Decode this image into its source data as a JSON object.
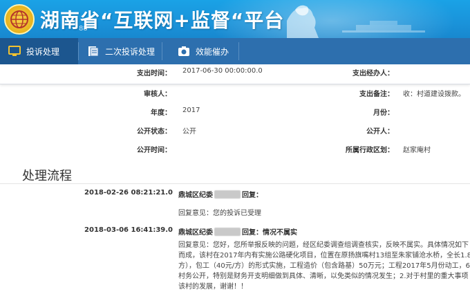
{
  "banner": {
    "title": "湖南省“互联网+监督“平台",
    "number": "88"
  },
  "nav": {
    "items": [
      {
        "label": "投诉处理",
        "icon": "monitor-icon",
        "active": true
      },
      {
        "label": "二次投诉处理",
        "icon": "document-icon",
        "active": false
      },
      {
        "label": "效能催办",
        "icon": "camera-icon",
        "active": false
      }
    ]
  },
  "details": {
    "pay_time_label": "支出时间：",
    "pay_time_value": "2017-06-30 00:00:00.0",
    "payer_label": "支出经办人：",
    "payer_value": "",
    "reviewer_label": "审核人：",
    "reviewer_value": "",
    "pay_note_label": "支出备注：",
    "pay_note_value": "收：村道建设拨款。",
    "year_label": "年度：",
    "year_value": "2017",
    "month_label": "月份：",
    "month_value": "",
    "public_status_label": "公开状态：",
    "public_status_value": "公开",
    "publisher_label": "公开人：",
    "publisher_value": "",
    "public_time_label": "公开时间：",
    "public_time_value": "",
    "region_label": "所属行政区划：",
    "region_value": "赵家庵村"
  },
  "process": {
    "title": "处理流程",
    "entries": [
      {
        "time": "2018-02-26 08:21:21.0",
        "org": "鼎城区纪委",
        "action": "回复：",
        "reply": "回复意见：您的投诉已受理",
        "lines": []
      },
      {
        "time": "2018-03-06 16:41:39.0",
        "org": "鼎城区纪委",
        "action": "回复：情况不属实",
        "reply": "",
        "lines": [
          "回复意见：您好，您所举报反映的问题，经区纪委调查组调查核实，反映不属实。具体情况如下",
          "而成，该村在2017年内有实施公路硬化项目，位置在原扬旗嘴村13组至朱家铺沧水桥，全长1.8",
          "方），包工（40元/方）的形式实施，工程造价（包含路基）50万元；工程2017年5月份动工，6",
          "村务公开，特别是财务开支明细做到具体、清晰，以免类似的情况发生；2.对于村里的重大事项",
          "该村的发展，谢谢！！"
        ]
      }
    ]
  },
  "colors": {
    "banner": "#1a93da",
    "nav": "#2d6fae",
    "nav_active": "#1c568f"
  }
}
